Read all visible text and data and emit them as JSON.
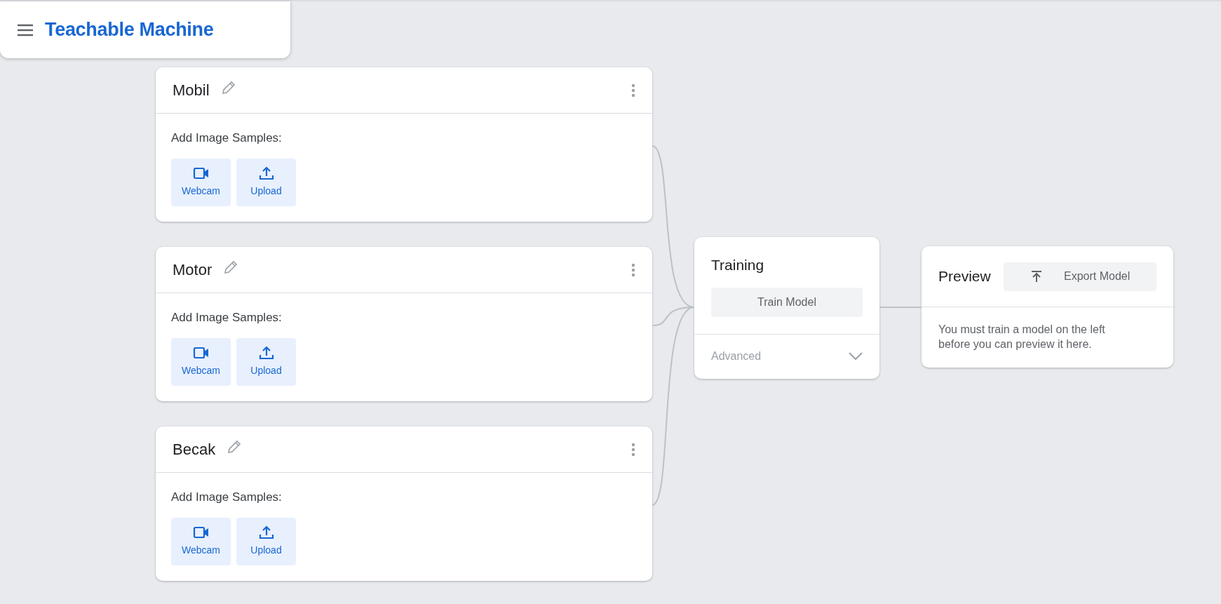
{
  "header": {
    "title": "Teachable Machine"
  },
  "classes": [
    {
      "name": "Mobil",
      "samples_label": "Add Image Samples:",
      "buttons": [
        {
          "kind": "webcam",
          "label": "Webcam"
        },
        {
          "kind": "upload",
          "label": "Upload"
        }
      ]
    },
    {
      "name": "Motor",
      "samples_label": "Add Image Samples:",
      "buttons": [
        {
          "kind": "webcam",
          "label": "Webcam"
        },
        {
          "kind": "upload",
          "label": "Upload"
        }
      ]
    },
    {
      "name": "Becak",
      "samples_label": "Add Image Samples:",
      "buttons": [
        {
          "kind": "webcam",
          "label": "Webcam"
        },
        {
          "kind": "upload",
          "label": "Upload"
        }
      ]
    }
  ],
  "training": {
    "title": "Training",
    "button": "Train Model",
    "advanced": "Advanced",
    "expanded": false
  },
  "preview": {
    "title": "Preview",
    "export_button": "Export Model",
    "message": "You must train a model on the left before you can preview it here."
  }
}
